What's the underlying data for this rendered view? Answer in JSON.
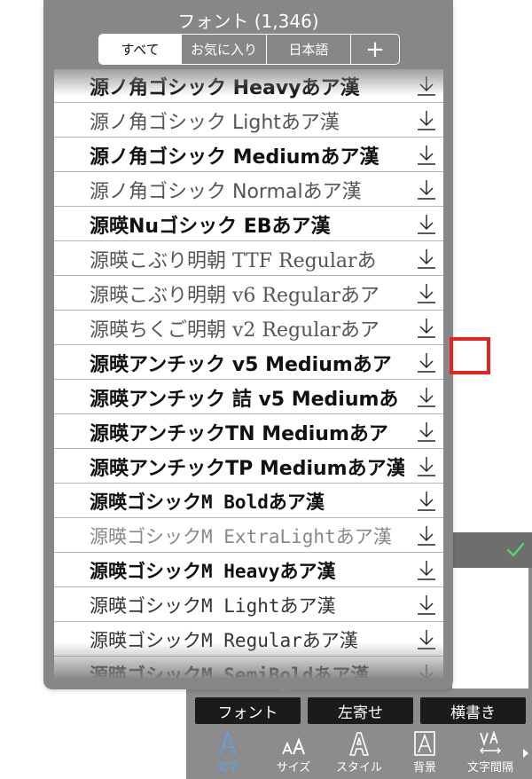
{
  "popup": {
    "title": "フォント (1,346)",
    "segments": [
      "すべて",
      "お気に入り",
      "日本語",
      "+"
    ],
    "active_segment": "すべて"
  },
  "font_list": [
    {
      "name": "源ノ角ゴシック Heavyあア漢",
      "style": "bold"
    },
    {
      "name": "源ノ角ゴシック Lightあア漢",
      "style": "light"
    },
    {
      "name": "源ノ角ゴシック Mediumあア漢",
      "style": "medium"
    },
    {
      "name": "源ノ角ゴシック Normalあア漢",
      "style": "normal"
    },
    {
      "name": "源暎Nuゴシック EBあア漢",
      "style": "bold"
    },
    {
      "name": "源暎こぶり明朝 TTF Regularあ",
      "style": "serif"
    },
    {
      "name": "源暎こぶり明朝 v6 Regularあア",
      "style": "serif"
    },
    {
      "name": "源暎ちくご明朝 v2 Regularあア",
      "style": "serif"
    },
    {
      "name": "源暎アンチック v5 Mediumあア",
      "style": "medium"
    },
    {
      "name": "源暎アンチック 詰 v5 Mediumあ",
      "style": "medium"
    },
    {
      "name": "源暎アンチックTN Mediumあア",
      "style": "medium"
    },
    {
      "name": "源暎アンチックTP Mediumあア漢",
      "style": "medium"
    },
    {
      "name": "源暎ゴシックM Boldあア漢",
      "style": "mono-bold"
    },
    {
      "name": "源暎ゴシックM ExtraLightあア漢",
      "style": "mono-light"
    },
    {
      "name": "源暎ゴシックM Heavyあア漢",
      "style": "mono-bold"
    },
    {
      "name": "源暎ゴシックM Lightあア漢",
      "style": "mono"
    },
    {
      "name": "源暎ゴシックM Regularあア漢",
      "style": "mono"
    },
    {
      "name": "源暎ゴシックM SemiBoldあア漢",
      "style": "mono-bold"
    }
  ],
  "highlighted_row_index": 8,
  "toolbar": {
    "buttons": [
      "フォント",
      "左寄せ",
      "横書き"
    ],
    "icons": [
      {
        "label": "文字",
        "icon": "text-a-icon",
        "selected": true
      },
      {
        "label": "サイズ",
        "icon": "font-size-icon",
        "selected": false
      },
      {
        "label": "スタイル",
        "icon": "outline-a-icon",
        "selected": false
      },
      {
        "label": "背景",
        "icon": "boxed-a-icon",
        "selected": false
      },
      {
        "label": "文字間隔",
        "icon": "letter-spacing-icon",
        "selected": false
      }
    ]
  },
  "colors": {
    "accent": "#5aa3ee",
    "highlight_box": "#e4231f",
    "check": "#4cd964"
  }
}
